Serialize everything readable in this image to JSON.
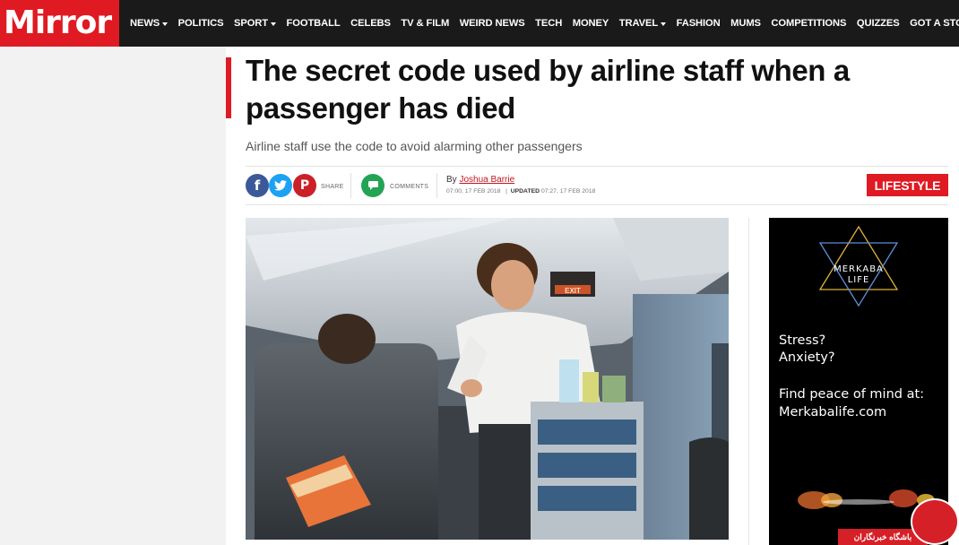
{
  "header": {
    "logo": "Mirror",
    "nav": [
      {
        "label": "NEWS",
        "dropdown": true
      },
      {
        "label": "POLITICS",
        "dropdown": false
      },
      {
        "label": "SPORT",
        "dropdown": true
      },
      {
        "label": "FOOTBALL",
        "dropdown": false
      },
      {
        "label": "CELEBS",
        "dropdown": false
      },
      {
        "label": "TV & FILM",
        "dropdown": false
      },
      {
        "label": "WEIRD NEWS",
        "dropdown": false
      },
      {
        "label": "TECH",
        "dropdown": false
      },
      {
        "label": "MONEY",
        "dropdown": false
      },
      {
        "label": "TRAVEL",
        "dropdown": true
      },
      {
        "label": "FASHION",
        "dropdown": false
      },
      {
        "label": "MUMS",
        "dropdown": false
      },
      {
        "label": "COMPETITIONS",
        "dropdown": false
      },
      {
        "label": "QUIZZES",
        "dropdown": false
      },
      {
        "label": "GOT A STORY?",
        "dropdown": false
      }
    ]
  },
  "article": {
    "title": "The secret code used by airline staff when a passenger has died",
    "subtitle": "Airline staff use the code to avoid alarming other passengers",
    "share_label": "SHARE",
    "comments_label": "COMMENTS",
    "by_prefix": "By",
    "author": "Joshua Barrie",
    "published": "07:00, 17 FEB 2018",
    "updated_label": "UPDATED",
    "updated": "07:27, 17 FEB 2018",
    "category": "LIFESTYLE",
    "exit_sign": "EXIT"
  },
  "ad": {
    "logo_line1": "MERKABA",
    "logo_line2": "LIFE",
    "line1": "Stress?",
    "line2": "Anxiety?",
    "line3": "Find peace of mind at:",
    "line4": "Merkabalife.com"
  },
  "watermark": {
    "text": "باشگاه خبرنگاران"
  },
  "colors": {
    "brand_red": "#e01a22",
    "nav_bg": "#1a1a1a",
    "facebook": "#3b5998",
    "twitter": "#1da1f2",
    "pinterest": "#cb2027",
    "comments": "#23a455"
  },
  "icons": [
    "facebook-icon",
    "twitter-icon",
    "pinterest-icon",
    "comment-icon",
    "chevron-down-icon",
    "merkaba-star-icon"
  ]
}
